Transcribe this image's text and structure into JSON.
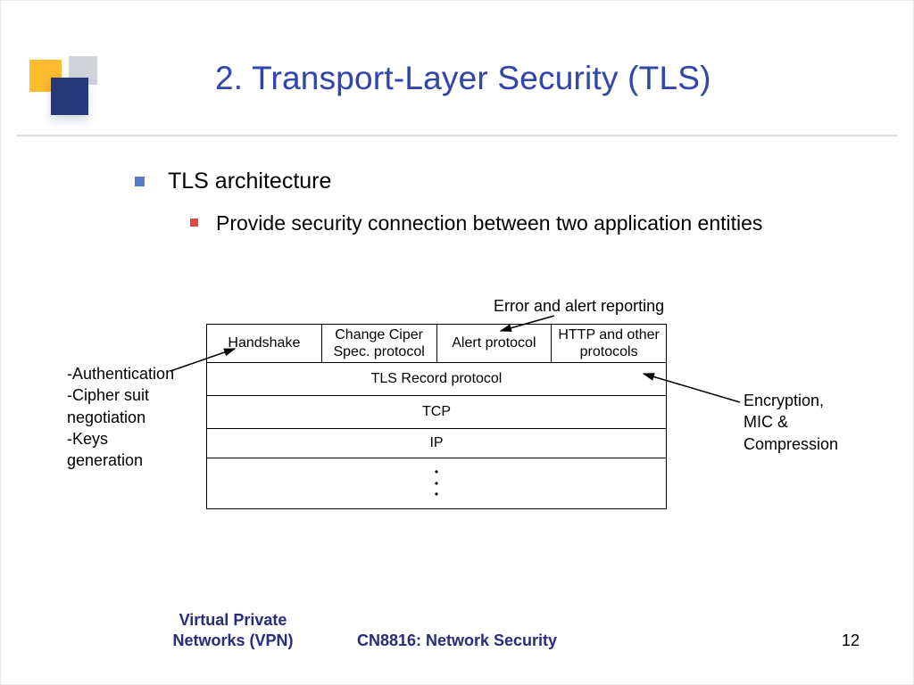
{
  "title": "2. Transport-Layer Security (TLS)",
  "bullet1": "TLS architecture",
  "bullet2": "Provide security connection between two application entities",
  "diagram": {
    "top_row": [
      "Handshake",
      "Change Ciper Spec. protocol",
      "Alert protocol",
      "HTTP and other protocols"
    ],
    "record": "TLS Record protocol",
    "tcp": "TCP",
    "ip": "IP"
  },
  "annotations": {
    "top": "Error and alert reporting",
    "left_lines": [
      "-Authentication",
      "-Cipher suit",
      "  negotiation",
      "-Keys",
      "  generation"
    ],
    "right_lines": [
      "Encryption,",
      "MIC &",
      "Compression"
    ]
  },
  "footer": {
    "left": "Virtual Private Networks (VPN)",
    "center": "CN8816: Network Security",
    "right": "12"
  }
}
